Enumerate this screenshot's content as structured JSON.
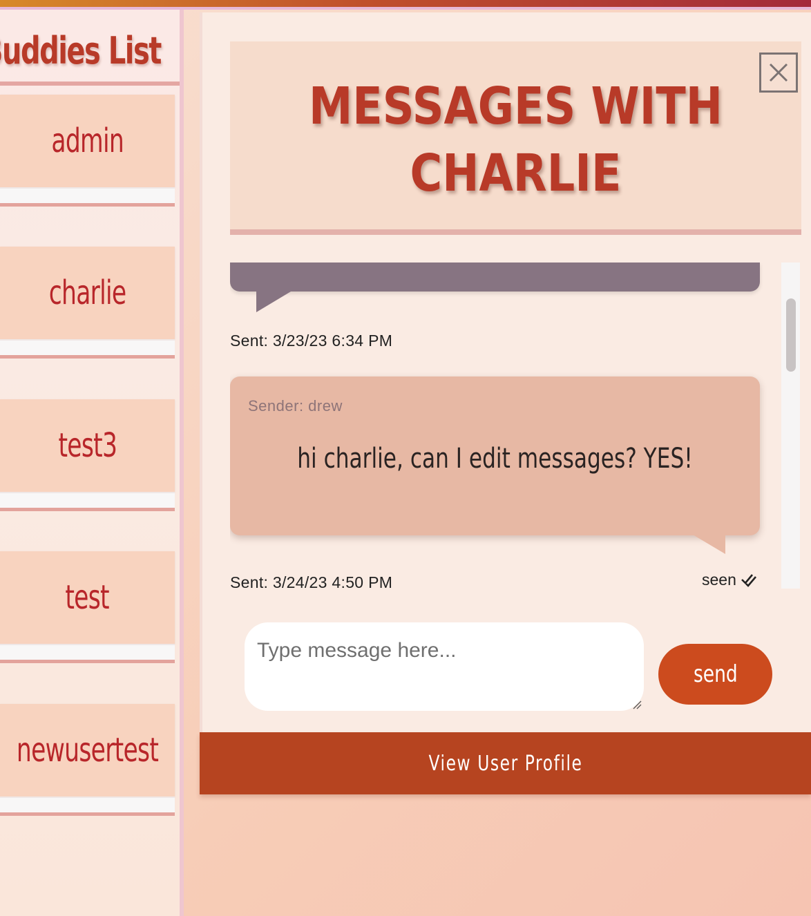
{
  "sidebar": {
    "title": "Buddies List",
    "buddies": [
      {
        "name": "admin"
      },
      {
        "name": "charlie"
      },
      {
        "name": "test3"
      },
      {
        "name": "test"
      },
      {
        "name": "newusertest"
      }
    ]
  },
  "header": {
    "title_line1": "MESSAGES WITH",
    "title_line2": "CHARLIE"
  },
  "messages": [
    {
      "sent": "Sent: 3/23/23 6:34 PM"
    },
    {
      "sender": "Sender: drew",
      "text": "hi charlie, can I edit messages? YES!",
      "sent": "Sent: 3/24/23 4:50 PM",
      "status": "seen"
    }
  ],
  "composer": {
    "placeholder": "Type message here...",
    "send_label": "send"
  },
  "profile_button": {
    "label": "View User Profile"
  },
  "icons": {
    "close": "close-icon",
    "seen": "double-check-icon"
  },
  "colors": {
    "accent": "#b64420",
    "send": "#cc4b1e",
    "title": "#b83a28"
  }
}
